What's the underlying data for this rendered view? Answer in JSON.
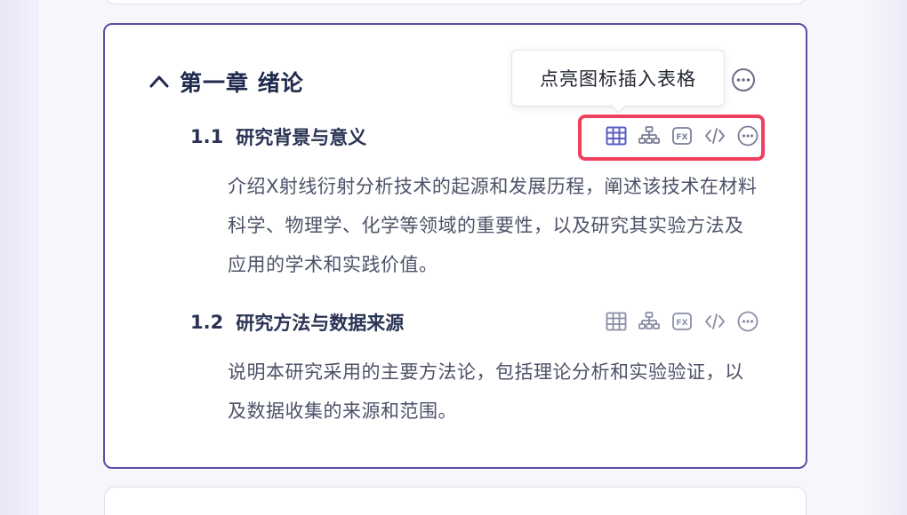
{
  "chapter": {
    "title": "第一章  绪论",
    "icons": {
      "collapse": "chevron-up-icon",
      "more": "more-horizontal-icon"
    }
  },
  "tooltip": {
    "text": "点亮图标插入表格"
  },
  "sections": [
    {
      "number": "1.1",
      "title": "研究背景与意义",
      "body": "介绍X射线衍射分析技术的起源和发展历程，阐述该技术在材料科学、物理学、化学等领域的重要性，以及研究其实验方法及应用的学术和实践价值。",
      "toolbar_highlighted": true
    },
    {
      "number": "1.2",
      "title": "研究方法与数据来源",
      "body": "说明本研究采用的主要方法论，包括理论分析和实验验证，以及数据收集的来源和范围。",
      "toolbar_highlighted": false
    }
  ],
  "toolbar_icons": [
    "table-icon",
    "org-chart-icon",
    "formula-fx-icon",
    "code-icon",
    "more-horizontal-icon"
  ],
  "colors": {
    "card_border": "#5a4fa6",
    "highlight": "#f0405e",
    "active_icon": "#5a5cc4",
    "inactive_icon": "#8a8fa6",
    "title_text": "#1f2a4d",
    "body_text": "#4d5268"
  }
}
